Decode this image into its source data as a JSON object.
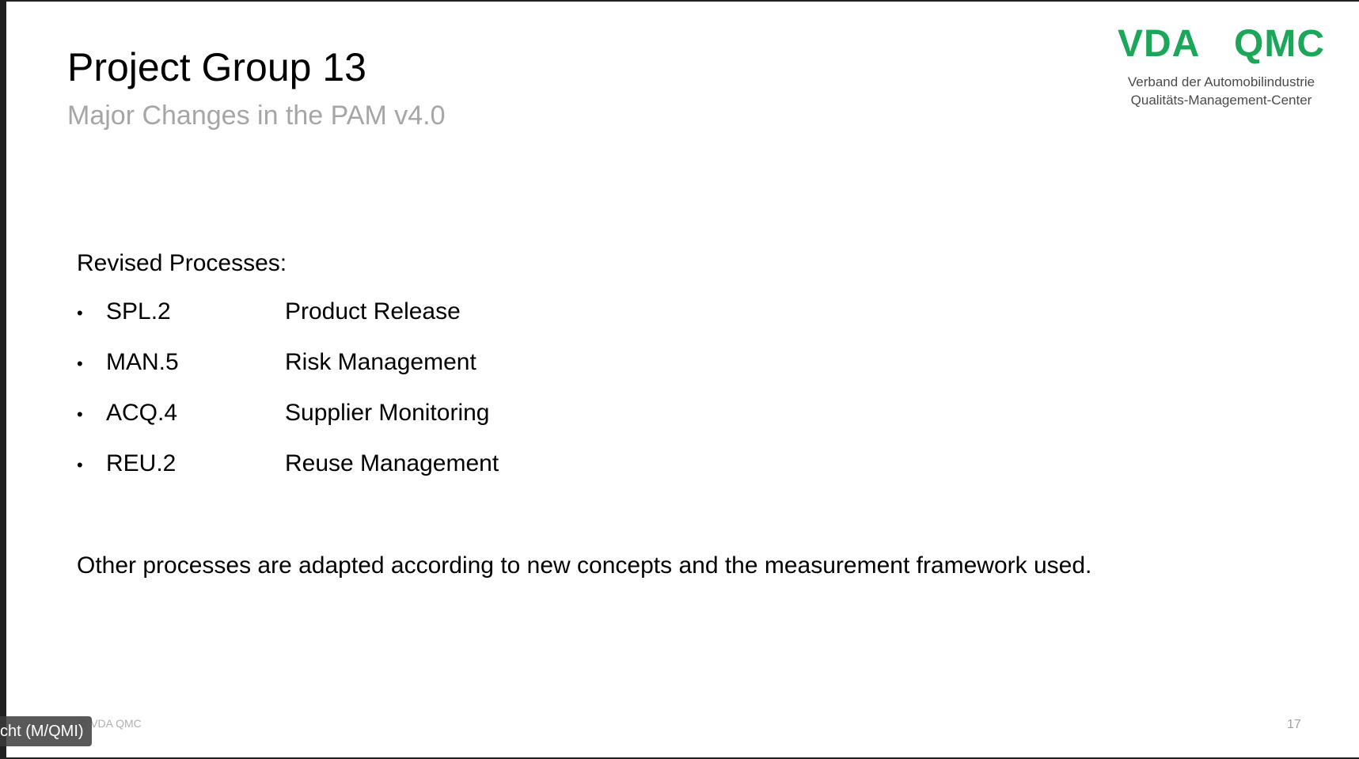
{
  "slide": {
    "title": "Project Group 13",
    "subtitle": "Major Changes in the PAM v4.0",
    "logo": {
      "left_mark": "VDA",
      "right_mark": "QMC",
      "line1": "Verband der Automobilindustrie",
      "line2": "Qualitäts-Management-Center",
      "brand_color": "#1ba65a"
    },
    "section_label": "Revised Processes:",
    "processes": [
      {
        "code": "SPL.2",
        "name": "Product Release"
      },
      {
        "code": "MAN.5",
        "name": "Risk Management"
      },
      {
        "code": "ACQ.4",
        "name": "Supplier Monitoring"
      },
      {
        "code": "REU.2",
        "name": "Reuse Management"
      }
    ],
    "note": "Other processes are adapted according to new concepts and the measurement framework used.",
    "footer": {
      "copyright": "© VDA QMC",
      "page_number": "17"
    }
  },
  "overlay": {
    "speaker_tag": "cht (M/QMI)"
  }
}
